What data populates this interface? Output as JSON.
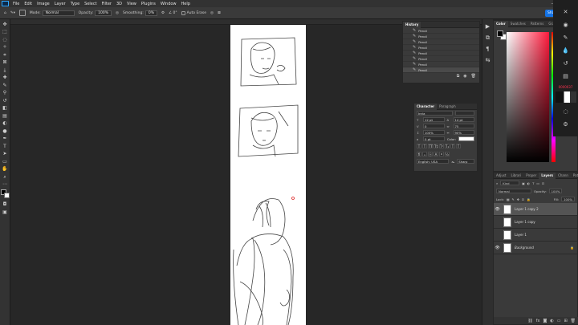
{
  "menubar": {
    "items": [
      "File",
      "Edit",
      "Image",
      "Layer",
      "Type",
      "Select",
      "Filter",
      "3D",
      "View",
      "Plugins",
      "Window",
      "Help"
    ],
    "window_controls": [
      "–",
      "▢",
      "✕"
    ]
  },
  "options": {
    "mode_label": "Mode:",
    "mode_value": "Normal",
    "opacity_label": "Opacity:",
    "opacity_value": "100%",
    "smoothing_label": "Smoothing:",
    "smoothing_value": "0%",
    "auto_erase": "Auto Erase",
    "share": "Share"
  },
  "history": {
    "tabs": [
      "History"
    ],
    "items": [
      "Pencil",
      "Pencil",
      "Pencil",
      "Pencil",
      "Pencil",
      "Pencil",
      "Pencil",
      "Pencil"
    ]
  },
  "character": {
    "tabs": [
      "Character",
      "Paragraph"
    ],
    "font_family": "Inria",
    "size": "12 pt",
    "leading": "14 pt",
    "tracking": "0",
    "kerning": "75",
    "vscale": "100%",
    "hscale": "90%",
    "baseline": "0 pt",
    "color_label": "Color:",
    "language": "English: USA",
    "aa": "Sharp",
    "aa_label": "aₐ",
    "format_buttons": [
      "T",
      "T",
      "TT",
      "Tt",
      "T¹",
      "T₁",
      "T",
      "T"
    ]
  },
  "color_panel": {
    "tabs": [
      "Color",
      "Swatches",
      "Patterns",
      "Gradi"
    ],
    "fg_color": "#000000",
    "bg_color": "#ffffff",
    "hue_hex": "#ff1a3c"
  },
  "float_panel": {
    "value": "0000037"
  },
  "layers": {
    "tabs": [
      "Adjust",
      "Librari",
      "Proper",
      "Layers",
      "Chann",
      "Paths"
    ],
    "kind": "Kind",
    "blend": "Normal",
    "opacity_label": "Opacity:",
    "opacity_value": "100%",
    "lock_label": "Lock:",
    "fill_label": "Fill:",
    "fill_value": "100%",
    "rows": [
      {
        "name": "Layer 1 copy 2",
        "visible": true,
        "selected": true
      },
      {
        "name": "Layer 1 copy",
        "visible": false,
        "selected": false
      },
      {
        "name": "Layer 1",
        "visible": false,
        "selected": false
      },
      {
        "name": "Background",
        "visible": true,
        "selected": false
      }
    ],
    "lock_glyph": "🔒"
  },
  "colors": {
    "accent": "#1473e6",
    "panel": "#3a3a3a",
    "canvas_bg": "#272727"
  }
}
